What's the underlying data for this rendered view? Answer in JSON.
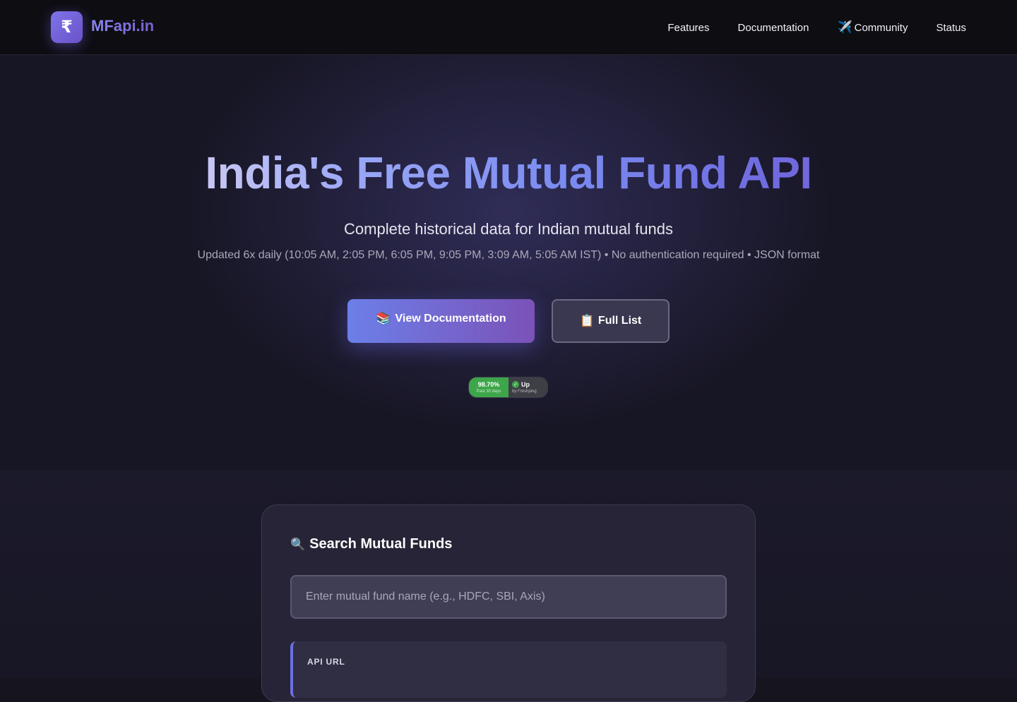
{
  "brand": {
    "logo_symbol": "₹",
    "name": "MFapi.in"
  },
  "nav": {
    "items": [
      {
        "label": "Features",
        "icon": ""
      },
      {
        "label": "Documentation",
        "icon": ""
      },
      {
        "label": "Community",
        "icon": "✈️"
      },
      {
        "label": "Status",
        "icon": ""
      }
    ]
  },
  "hero": {
    "title": "India's Free Mutual Fund API",
    "subtitle": "Complete historical data for Indian mutual funds",
    "note": "Updated 6x daily (10:05 AM, 2:05 PM, 6:05 PM, 9:05 PM, 3:09 AM, 5:05 AM IST) • No authentication required • JSON format",
    "primary_button": {
      "icon": "📚",
      "label": "View Documentation"
    },
    "secondary_button": {
      "icon": "📋",
      "label": "Full List"
    }
  },
  "uptime_badge": {
    "percent": "98.70%",
    "period": "Past 30 days",
    "status": "Up",
    "provider": "by Freshping"
  },
  "search": {
    "icon": "🔍",
    "title": "Search Mutual Funds",
    "placeholder": "Enter mutual fund name (e.g., HDFC, SBI, Axis)",
    "value": "",
    "api_label": "API URL"
  },
  "colors": {
    "accent": "#6c7fe8",
    "accent_end": "#7b52b8",
    "header_bg": "#0d0d12",
    "uptime_green": "#3da64a"
  }
}
